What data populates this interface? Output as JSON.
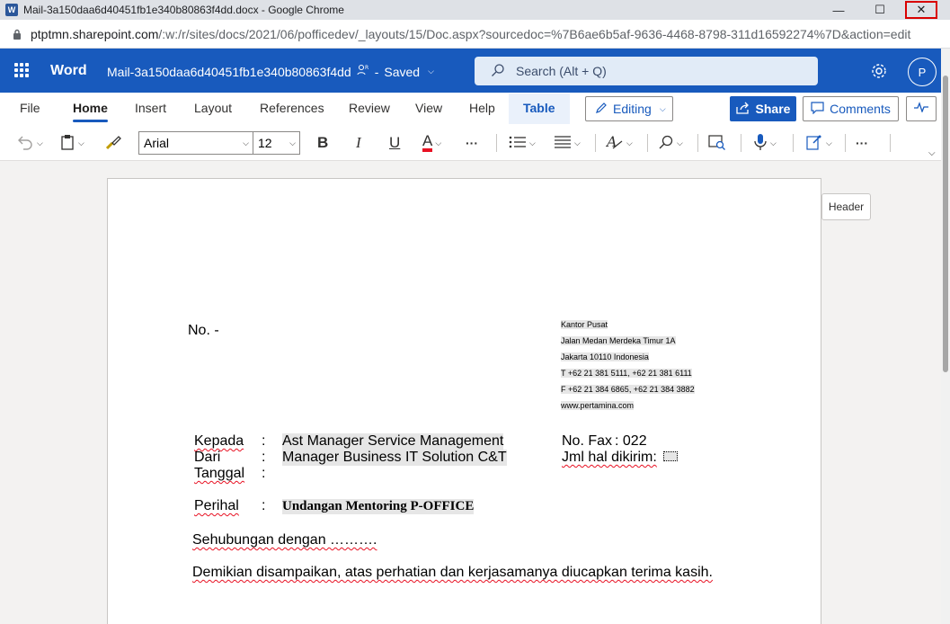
{
  "browser": {
    "title": "Mail-3a150daa6d40451fb1e340b80863f4dd.docx - Google Chrome",
    "url_host": "ptptmn.sharepoint.com",
    "url_path": "/:w:/r/sites/docs/2021/06/pofficedev/_layouts/15/Doc.aspx?sourcedoc=%7B6ae6b5af-9636-4468-8798-311d16592274%7D&action=edit",
    "min_glyph": "—",
    "max_glyph": "☐",
    "close_glyph": "✕"
  },
  "word": {
    "app_name": "Word",
    "doc_name": "Mail-3a150daa6d40451fb1e340b80863f4dd",
    "saved": "Saved",
    "search_placeholder": "Search (Alt + Q)",
    "avatar_initial": "P"
  },
  "ribbon": {
    "tabs": [
      "File",
      "Home",
      "Insert",
      "Layout",
      "References",
      "Review",
      "View",
      "Help",
      "Table"
    ],
    "active_tab": "Home",
    "editing_label": "Editing",
    "share_label": "Share",
    "comments_label": "Comments"
  },
  "toolbar": {
    "font_name": "Arial",
    "font_size": "12",
    "bold": "B",
    "italic": "I",
    "underline": "U",
    "font_color": "A",
    "more": "···",
    "font_color_hex": "#e81123"
  },
  "document": {
    "header_tag": "Header",
    "number": "No. -",
    "address": [
      "Kantor Pusat",
      "Jalan Medan Merdeka Timur 1A",
      "Jakarta 10110 Indonesia",
      "T +62 21 381 5111, +62 21 381 6111",
      "F +62 21 384 6865, +62 21 384 3882",
      "www.pertamina.com"
    ],
    "kepada_label": "Kepada",
    "kepada_value": "Ast Manager Service Management",
    "dari_label": "Dari",
    "dari_value": "Manager Business IT Solution C&T",
    "tanggal_label": "Tanggal",
    "colon": ":",
    "fax_label": "No. Fax",
    "fax_value": ": 022",
    "jml_label": "Jml hal dikirim:",
    "perihal_label": "Perihal",
    "perihal_value": "Undangan Mentoring P-OFFICE",
    "body_line1": "Sehubungan dengan ……….",
    "body_line2": "Demikian disampaikan, atas perhatian dan kerjasamanya diucapkan terima kasih."
  }
}
